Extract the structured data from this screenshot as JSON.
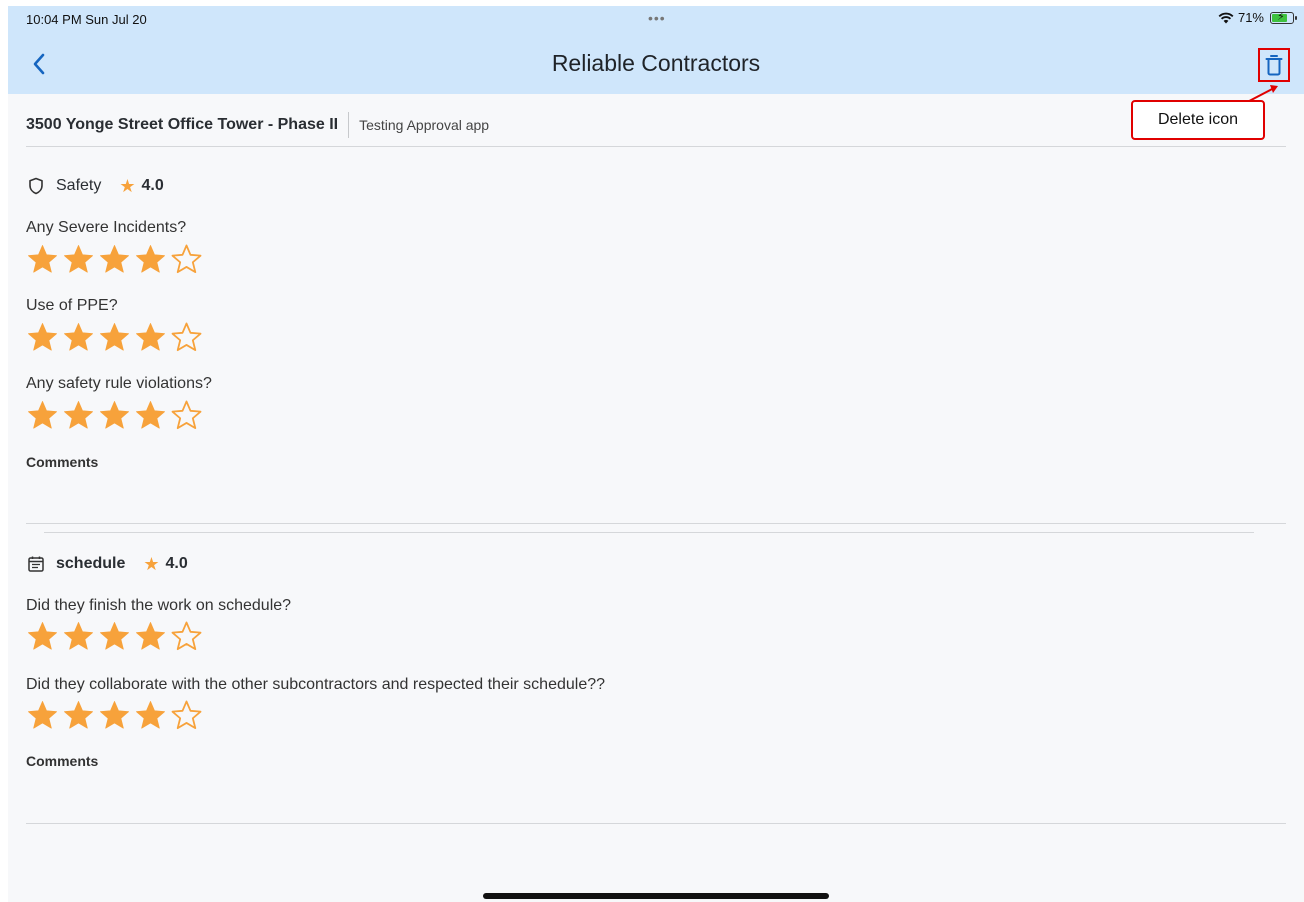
{
  "status_bar": {
    "time": "10:04 PM  Sun Jul 20",
    "dots": "•••",
    "battery": "71%"
  },
  "header": {
    "title": "Reliable Contractors",
    "back_icon": "chevron-left-icon",
    "delete_icon": "trash-icon"
  },
  "annotation": {
    "label": "Delete icon"
  },
  "project": {
    "name": "3500 Yonge Street Office Tower - Phase II",
    "subtitle": "Testing Approval app"
  },
  "colors": {
    "appbar": "#cfe6fb",
    "star": "#f7a23b",
    "accent": "#1565c0",
    "callout": "#e00000"
  },
  "sections": [
    {
      "icon": "shield-icon",
      "title": "Safety",
      "score": "4.0",
      "questions": [
        {
          "text": "Any Severe Incidents?",
          "rating": 4,
          "max": 5
        },
        {
          "text": "Use of PPE?",
          "rating": 4,
          "max": 5
        },
        {
          "text": "Any safety rule violations?",
          "rating": 4,
          "max": 5
        }
      ],
      "comments_label": "Comments"
    },
    {
      "icon": "calendar-icon",
      "title": "schedule",
      "score": "4.0",
      "questions": [
        {
          "text": "Did they finish the work on schedule?",
          "rating": 4,
          "max": 5
        },
        {
          "text": "Did they collaborate with the other subcontractors and respected their schedule??",
          "rating": 4,
          "max": 5
        }
      ],
      "comments_label": "Comments"
    }
  ]
}
